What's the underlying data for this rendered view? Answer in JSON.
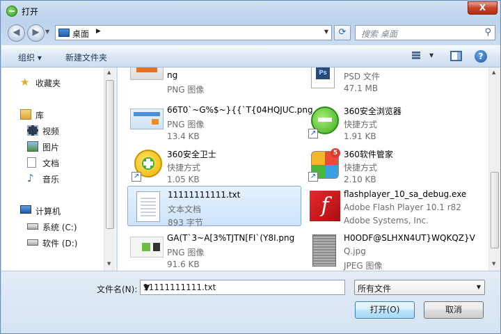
{
  "window": {
    "title": "打开",
    "close_label": "X"
  },
  "address": {
    "location": "桌面",
    "search_placeholder": "搜索 桌面"
  },
  "toolbar": {
    "organize_label": "组织 ▾",
    "new_folder_label": "新建文件夹"
  },
  "sidebar": {
    "items": [
      {
        "label": "收藏夹",
        "icon": "star-icon"
      },
      {
        "label": "库",
        "icon": "library-icon"
      },
      {
        "label": "视频",
        "icon": "video-icon"
      },
      {
        "label": "图片",
        "icon": "pictures-icon"
      },
      {
        "label": "文档",
        "icon": "documents-icon"
      },
      {
        "label": "音乐",
        "icon": "music-icon"
      },
      {
        "label": "计算机",
        "icon": "computer-icon"
      },
      {
        "label": "系统 (C:)",
        "icon": "drive-c-icon"
      },
      {
        "label": "软件 (D:)",
        "icon": "drive-d-icon"
      }
    ]
  },
  "files": [
    {
      "name": "ng",
      "type": "PNG 图像",
      "size": ""
    },
    {
      "name": "",
      "type": "PSD 文件",
      "size": "47.1 MB"
    },
    {
      "name": "66T0`~G%$~}{{`T{04HQJUC.png",
      "type": "PNG 图像",
      "size": "13.4 KB"
    },
    {
      "name": "360安全浏览器",
      "type": "快捷方式",
      "size": "1.91 KB"
    },
    {
      "name": "360安全卫士",
      "type": "快捷方式",
      "size": "1.05 KB"
    },
    {
      "name": "360软件管家",
      "type": "快捷方式",
      "size": "2.10 KB"
    },
    {
      "name": "11111111111.txt",
      "type": "文本文档",
      "size": "893 字节"
    },
    {
      "name": "flashplayer_10_sa_debug.exe",
      "type": "Adobe Flash Player 10.1 r82",
      "size": "Adobe Systems, Inc."
    },
    {
      "name": "GA(T`3~A[3%TJTN[FI`(Y8I.png",
      "type": "PNG 图像",
      "size": "91.6 KB"
    },
    {
      "name": "H0ODF@SLHXN4UT}WQKQZ}V",
      "name2": "Q.jpg",
      "type": "JPEG 图像"
    }
  ],
  "bottom": {
    "filename_label": "文件名(N):",
    "filename_value": "11111111111.txt",
    "filter_value": "所有文件",
    "open_label": "打开(O)",
    "cancel_label": "取消"
  }
}
